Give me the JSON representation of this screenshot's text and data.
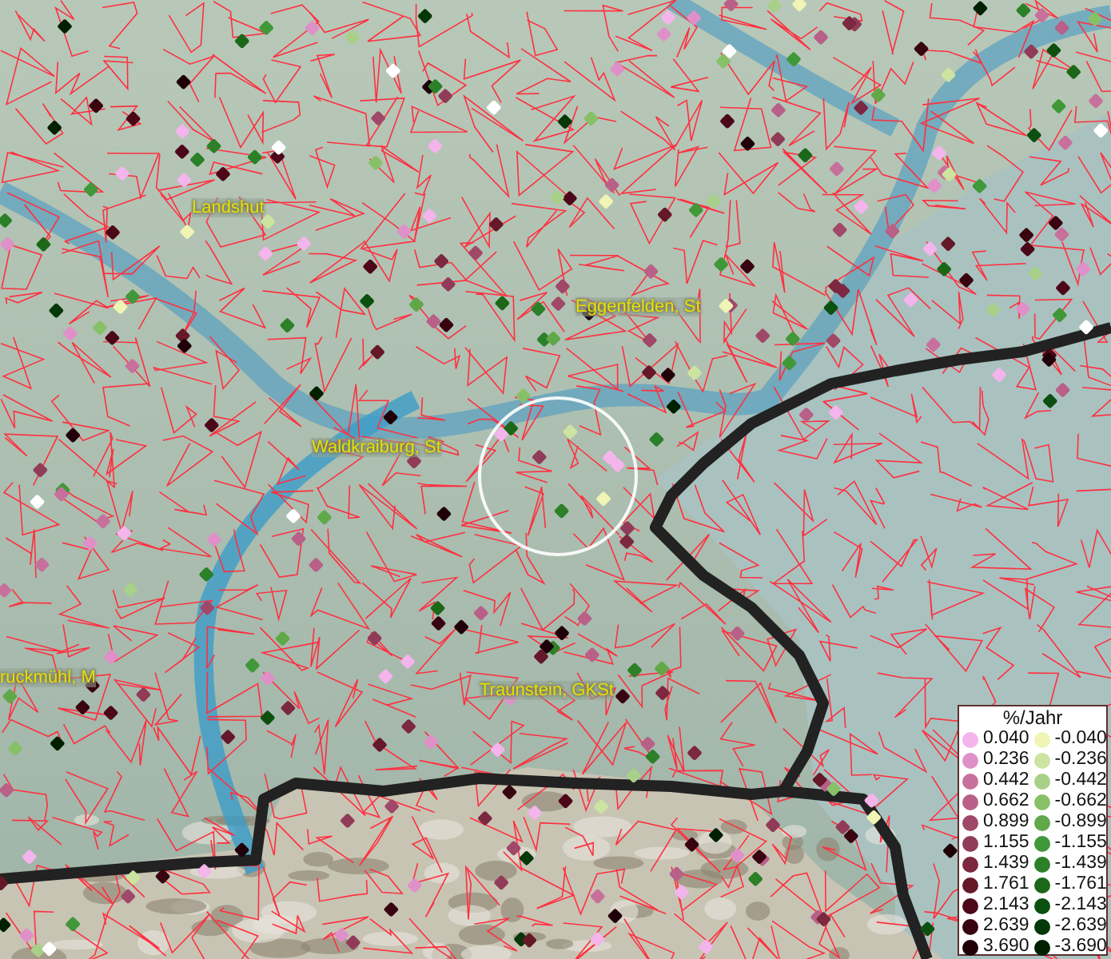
{
  "map": {
    "place_labels": [
      "Landshut",
      "Eggenfelden, St",
      "Waldkraiburg, St",
      "ruckmühl, M",
      "Traunstein, GKSt"
    ]
  },
  "legend": {
    "title": "%/Jahr",
    "rows": [
      {
        "positive": {
          "value": "0.040",
          "color": "#f4b4ec"
        },
        "negative": {
          "value": "-0.040",
          "color": "#f0f4b4"
        }
      },
      {
        "positive": {
          "value": "0.236",
          "color": "#e090c8"
        },
        "negative": {
          "value": "-0.236",
          "color": "#cce4a0"
        }
      },
      {
        "positive": {
          "value": "0.442",
          "color": "#c8709c"
        },
        "negative": {
          "value": "-0.442",
          "color": "#a8d088"
        }
      },
      {
        "positive": {
          "value": "0.662",
          "color": "#b86088"
        },
        "negative": {
          "value": "-0.662",
          "color": "#88c068"
        }
      },
      {
        "positive": {
          "value": "0.899",
          "color": "#a04868"
        },
        "negative": {
          "value": "-0.899",
          "color": "#60a848"
        }
      },
      {
        "positive": {
          "value": "1.155",
          "color": "#903c58"
        },
        "negative": {
          "value": "-1.155",
          "color": "#409838"
        }
      },
      {
        "positive": {
          "value": "1.439",
          "color": "#7c2840"
        },
        "negative": {
          "value": "-1.439",
          "color": "#2c8028"
        }
      },
      {
        "positive": {
          "value": "1.761",
          "color": "#641828"
        },
        "negative": {
          "value": "-1.761",
          "color": "#1c6818"
        }
      },
      {
        "positive": {
          "value": "2.143",
          "color": "#4c0818"
        },
        "negative": {
          "value": "-2.143",
          "color": "#0c5010"
        }
      },
      {
        "positive": {
          "value": "2.639",
          "color": "#380410"
        },
        "negative": {
          "value": "-2.639",
          "color": "#043808"
        }
      },
      {
        "positive": {
          "value": "3.690",
          "color": "#200008"
        },
        "negative": {
          "value": "-3.690",
          "color": "#002000"
        }
      }
    ]
  }
}
